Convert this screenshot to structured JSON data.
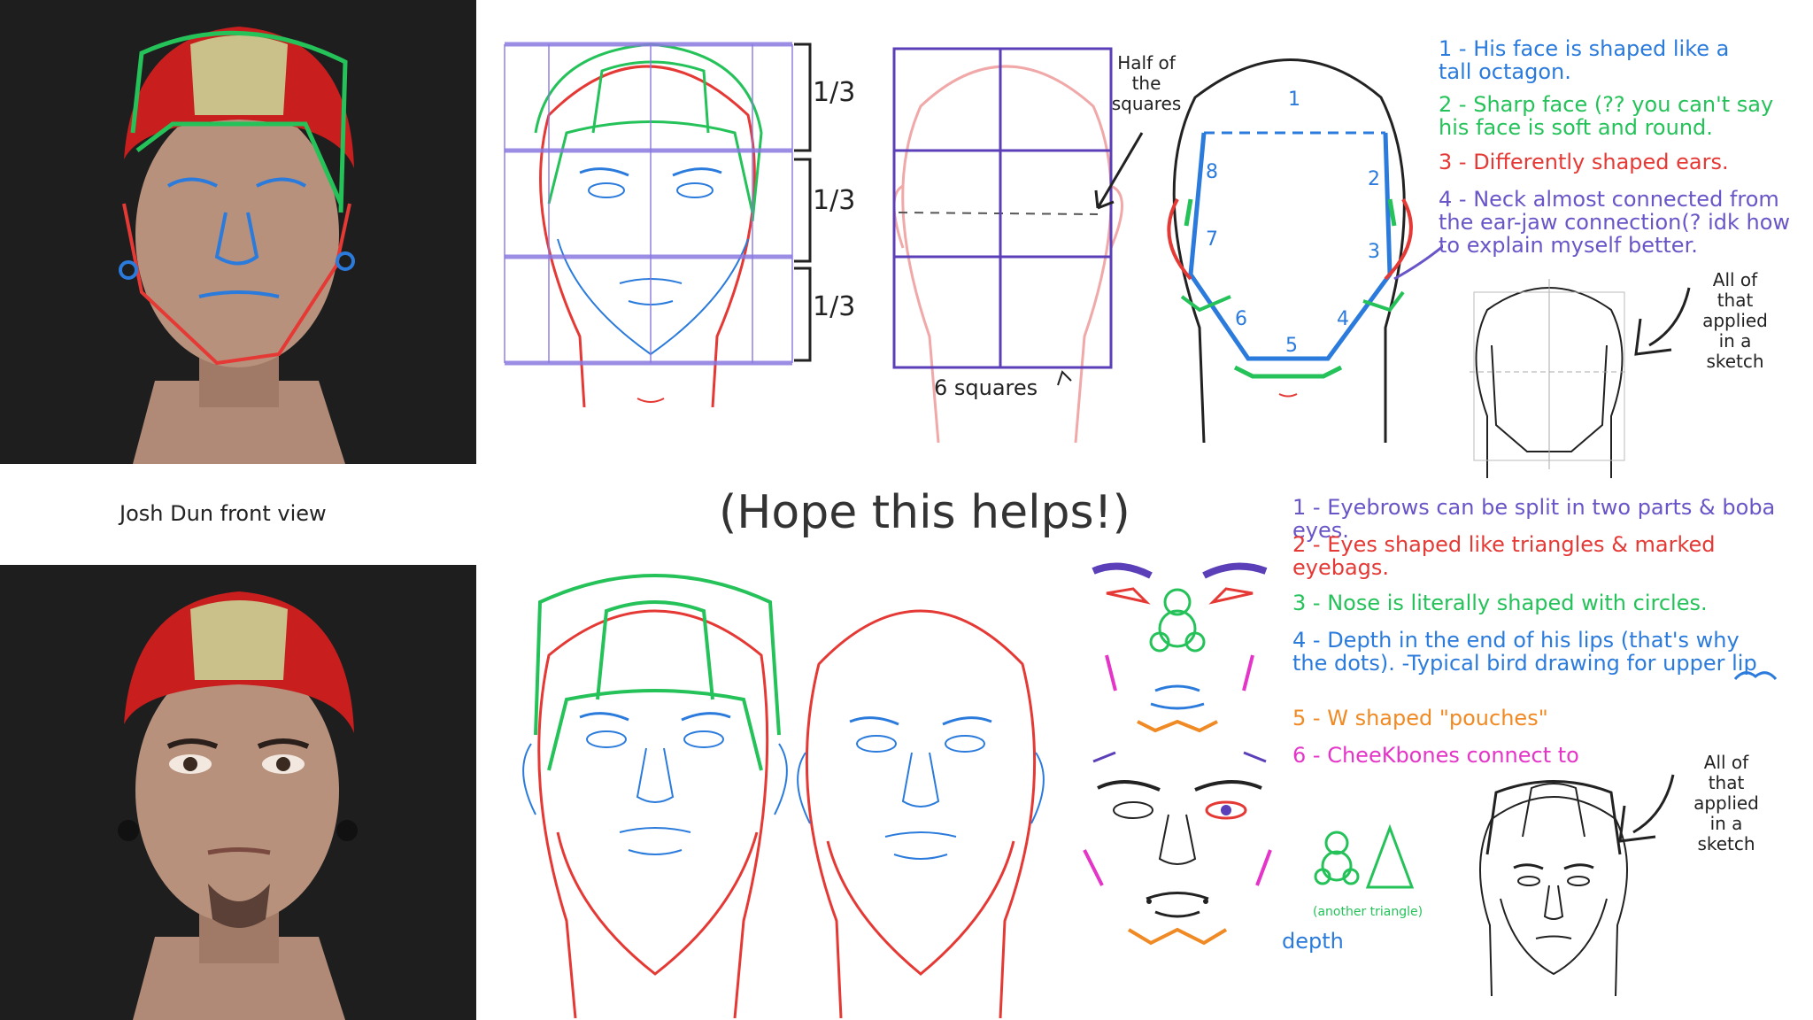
{
  "caption": "Josh Dun front view",
  "hope": "(Hope this helps!)",
  "thirds": [
    "1/3",
    "1/3",
    "1/3"
  ],
  "half_label": "Half of the squares",
  "six_squares": "6 squares",
  "applied_label": "All of that applied in a sketch",
  "face_numbers": [
    "1",
    "2",
    "3",
    "4",
    "5",
    "6",
    "7",
    "8"
  ],
  "top_notes": [
    {
      "num": "1",
      "text": "His face is shaped like a tall octagon.",
      "color": "#2b7bdc"
    },
    {
      "num": "2",
      "text": "Sharp face (?? you can't say his face is soft and round.",
      "color": "#25c25a"
    },
    {
      "num": "3",
      "text": "Differently shaped ears.",
      "color": "#e53935"
    },
    {
      "num": "4",
      "text": "Neck almost connected from the ear-jaw connection(? idk how to explain myself better.",
      "color": "#6a55c8"
    }
  ],
  "bottom_notes": [
    {
      "num": "1",
      "text": "Eyebrows can be split in two parts & boba eyes.",
      "color": "#6a55c8"
    },
    {
      "num": "2",
      "text": "Eyes shaped like triangles & marked eyebags.",
      "color": "#e53935"
    },
    {
      "num": "3",
      "text": "Nose is literally shaped with circles.",
      "color": "#25c25a"
    },
    {
      "num": "4",
      "text": "Depth in the end of his lips (that's why the dots). -Typical bird drawing for upper lip",
      "color": "#2b7bdc"
    },
    {
      "num": "5",
      "text": "W shaped \"pouches\"",
      "color": "#f08a24"
    },
    {
      "num": "6",
      "text": "CheeKbones connect to",
      "color": "#e535c8"
    }
  ],
  "another_triangle": "(another triangle)",
  "depth_label": "depth",
  "colors": {
    "blue": "#2b7bdc",
    "green": "#25c25a",
    "red": "#e53935",
    "purple": "#6a55c8",
    "orange": "#f08a24",
    "magenta": "#e535c8"
  }
}
